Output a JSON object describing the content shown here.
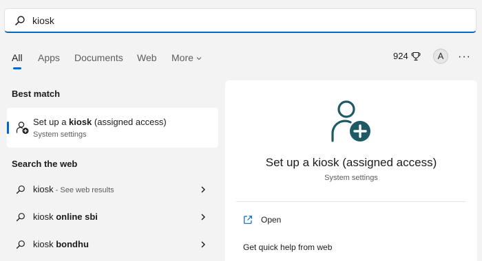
{
  "search": {
    "value": "kiosk",
    "icon": "search-icon"
  },
  "tabs": [
    {
      "label": "All",
      "active": true
    },
    {
      "label": "Apps"
    },
    {
      "label": "Documents"
    },
    {
      "label": "Web"
    },
    {
      "label": "More"
    }
  ],
  "header": {
    "rewards_points": "924",
    "avatar_initial": "A",
    "more_options": "···"
  },
  "best_match": {
    "heading": "Best match",
    "item": {
      "title_prefix": "Set up a ",
      "title_bold": "kiosk",
      "title_suffix": " (assigned access)",
      "subtitle": "System settings"
    }
  },
  "web": {
    "heading": "Search the web",
    "results": [
      {
        "query": "kiosk",
        "bold": "",
        "hint": " - See web results"
      },
      {
        "query": "kiosk ",
        "bold": "online sbi",
        "hint": ""
      },
      {
        "query": "kiosk ",
        "bold": "bondhu",
        "hint": ""
      }
    ]
  },
  "detail": {
    "title": "Set up a kiosk (assigned access)",
    "subtitle": "System settings",
    "actions": {
      "open": "Open",
      "help": "Get quick help from web"
    }
  },
  "colors": {
    "accent": "#0067c0",
    "icon_teal": "#1f5964",
    "background": "#f3f3f3"
  }
}
